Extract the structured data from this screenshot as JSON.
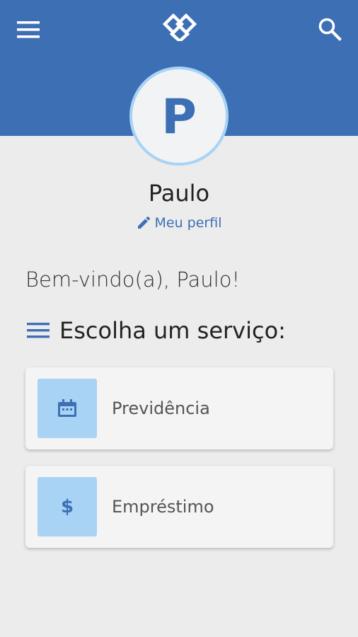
{
  "header": {
    "menu_icon": "menu-icon",
    "logo_icon": "diamond-logo-icon",
    "search_icon": "search-icon",
    "background_color": "#3d6fb5"
  },
  "profile": {
    "avatar_letter": "P",
    "name": "Paulo",
    "edit_link": "Meu perfil",
    "avatar_border_color": "#a8d3f5"
  },
  "welcome_text": "Bem-vindo(a), Paulo!",
  "services": {
    "title": "Escolha um serviço:",
    "items": [
      {
        "label": "Previdência",
        "icon": "calendar-icon"
      },
      {
        "label": "Empréstimo",
        "icon": "dollar-icon",
        "symbol": "$"
      }
    ]
  }
}
